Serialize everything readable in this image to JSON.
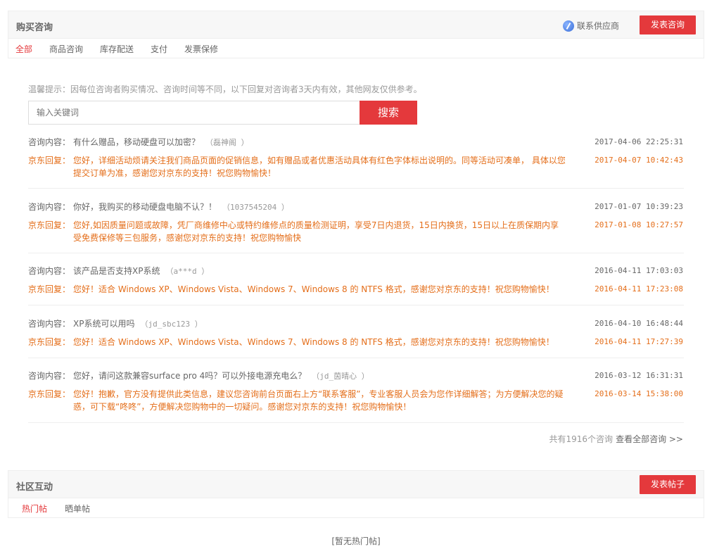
{
  "consult": {
    "title": "购买咨询",
    "supplier_label": "联系供应商",
    "post_button": "发表咨询",
    "tabs": [
      {
        "label": "全部"
      },
      {
        "label": "商品咨询"
      },
      {
        "label": "库存配送"
      },
      {
        "label": "支付"
      },
      {
        "label": "发票保修"
      }
    ],
    "tip": "温馨提示：因每位咨询者购买情况、咨询时间等不同，以下回复对咨询者3天内有效，其他网友仅供参考。",
    "search_placeholder": "输入关键词",
    "search_button": "搜索",
    "question_label": "咨询内容：",
    "answer_label": "京东回复：",
    "items": [
      {
        "question": "有什么赠品，移动硬盘可以加密？",
        "asker": "（磊神阁 ）",
        "q_time": "2017-04-06 22:25:31",
        "answer": "您好，详细活动烦请关注我们商品页面的促销信息，如有赠品或者优惠活动具体有红色字体标出说明的。同等活动可凑单， 具体以您提交订单为准，感谢您对京东的支持！祝您购物愉快！",
        "a_time": "2017-04-07 10:42:43"
      },
      {
        "question": "你好，我购买的移动硬盘电脑不认？！",
        "asker": "（1037545204 ）",
        "q_time": "2017-01-07 10:39:23",
        "answer": "您好,如因质量问题或故障，凭厂商维修中心或特约维修点的质量检测证明，享受7日内退货，15日内换货，15日以上在质保期内享受免费保修等三包服务，感谢您对京东的支持！祝您购物愉快",
        "a_time": "2017-01-08 10:27:57"
      },
      {
        "question": "该产品是否支持XP系统",
        "asker": "（a***d ）",
        "q_time": "2016-04-11 17:03:03",
        "answer": "您好！适合 Windows XP、Windows Vista、Windows 7、Windows 8 的 NTFS 格式，感谢您对京东的支持！祝您购物愉快！",
        "a_time": "2016-04-11 17:23:08"
      },
      {
        "question": "XP系统可以用吗",
        "asker": "（jd_sbc123 ）",
        "q_time": "2016-04-10 16:48:44",
        "answer": "您好！适合 Windows XP、Windows Vista、Windows 7、Windows 8 的 NTFS 格式，感谢您对京东的支持！祝您购物愉快！",
        "a_time": "2016-04-11 17:27:39"
      },
      {
        "question": "您好，请问这款兼容surface pro 4吗？可以外接电源充电么？",
        "asker": "（jd_茵晴心 ）",
        "q_time": "2016-03-12 16:31:31",
        "answer": "您好！抱歉，官方没有提供此类信息，建议您咨询前台页面右上方“联系客服”，专业客服人员会为您作详细解答；为方便解决您的疑惑，可下载“咚咚”，方便解决您购物中的一切疑问。感谢您对京东的支持！祝您购物愉快！",
        "a_time": "2016-03-14 15:38:00"
      }
    ],
    "total_text": "共有1916个咨询",
    "view_all": "查看全部咨询 >>"
  },
  "community": {
    "title": "社区互动",
    "post_button": "发表帖子",
    "tabs": [
      {
        "label": "热门帖"
      },
      {
        "label": "晒单帖"
      }
    ],
    "empty_text": "[暂无热门帖]"
  },
  "colors": {
    "accent": "#e4393c",
    "reply": "#e46e1a"
  }
}
